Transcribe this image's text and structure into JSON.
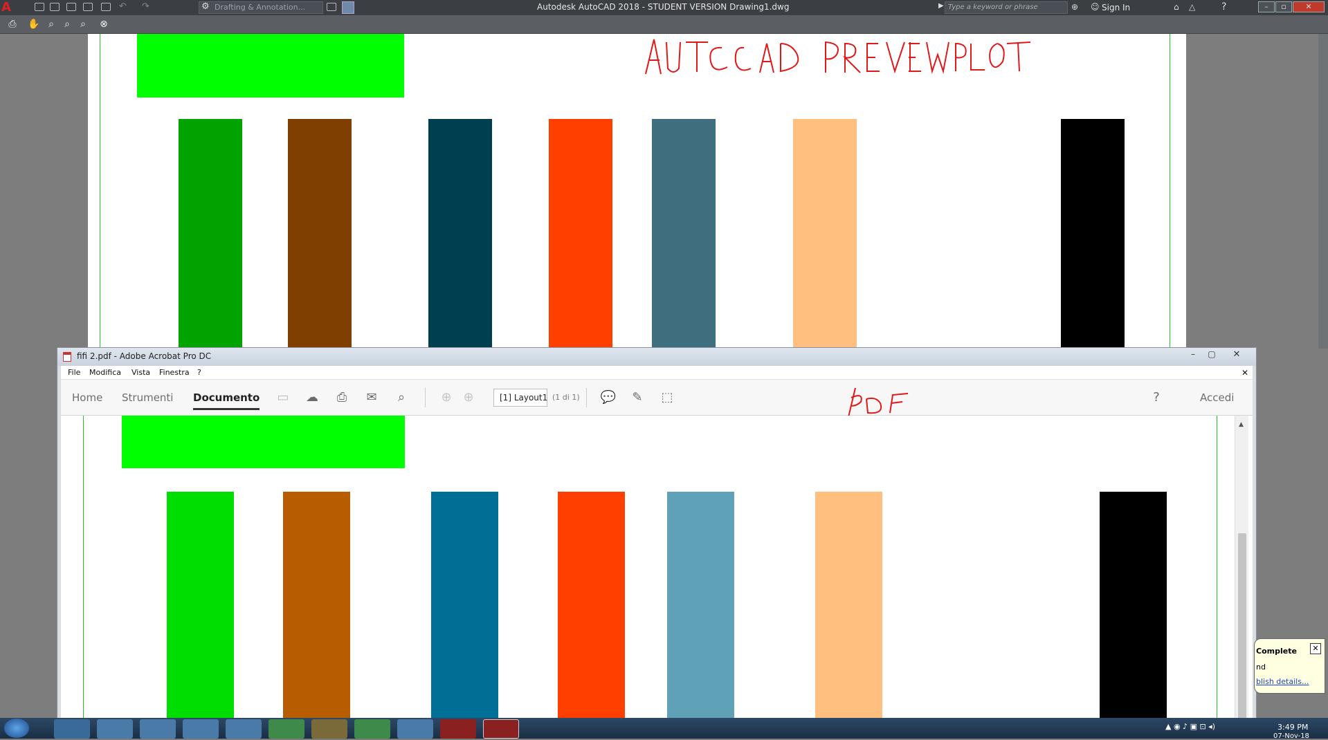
{
  "autocad": {
    "title": "Autodesk AutoCAD 2018 - STUDENT VERSION    Drawing1.dwg",
    "workspace": "Drafting & Annotation...",
    "search_placeholder": "Type a keyword or phrase",
    "sign_in": "Sign In",
    "annotation": "AUTO CAD PREVIEWPLOT",
    "bar_colors": [
      "#00a300",
      "#7f3f00",
      "#003f4f",
      "#ff3f00",
      "#3f6f7f",
      "#ffbf7f",
      "#000000"
    ],
    "rect_color": "#00ff00"
  },
  "acrobat": {
    "title": "fifi 2.pdf - Adobe Acrobat Pro DC",
    "menu": [
      "File",
      "Modifica",
      "Vista",
      "Finestra",
      "?"
    ],
    "tabs": [
      "Home",
      "Strumenti",
      "Documento"
    ],
    "active_tab": "Documento",
    "page_field": "[1] Layout1",
    "page_count": "(1 di 1)",
    "sign_in": "Accedi",
    "annotation": "PDF",
    "bar_colors": [
      "#00dd00",
      "#b85c00",
      "#006f95",
      "#ff3f00",
      "#5fa2b8",
      "#ffbf7f",
      "#000000"
    ],
    "rect_color": "#00ff00"
  },
  "notification": {
    "line1": "Complete",
    "line2": "nd",
    "link": "blish details..."
  },
  "taskbar": {
    "time": "3:49 PM",
    "date": "07-Nov-18"
  }
}
